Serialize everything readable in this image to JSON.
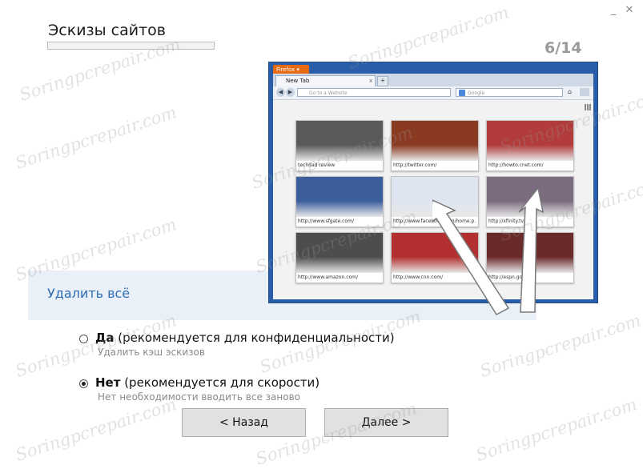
{
  "window": {
    "minimize_label": "_",
    "close_label": "✕"
  },
  "header": {
    "title": "Эскизы сайтов",
    "step": "6/14",
    "progress_fraction": 0.0
  },
  "section": {
    "label": "Удалить всё"
  },
  "browser_preview": {
    "app_button": "Firefox ▾",
    "tab_label": "New Tab",
    "tab_close": "x",
    "new_tab": "+",
    "url_placeholder": "Go to a Website",
    "search_placeholder": "Google",
    "thumbnails": [
      {
        "caption": "techdad review",
        "color": "#5a5a5a"
      },
      {
        "caption": "http://twitter.com/",
        "color": "#8b3a22"
      },
      {
        "caption": "http://howto.cnet.com/",
        "color": "#b23b3b"
      },
      {
        "caption": "http://www.sfgate.com/",
        "color": "#3b5d9c"
      },
      {
        "caption": "http://www.facebook.com/home.p...",
        "color": "#dfe5f0"
      },
      {
        "caption": "http://xfinity.tv.com/",
        "color": "#7a6b7e"
      },
      {
        "caption": "http://www.amazon.com/",
        "color": "#4d4d4d"
      },
      {
        "caption": "http://www.cnn.com/",
        "color": "#b23030"
      },
      {
        "caption": "http://espn.go.com/",
        "color": "#6a2a2a"
      }
    ]
  },
  "options": [
    {
      "title": "Да",
      "suffix": " (рекомендуется для конфиденциальности)",
      "subtitle": "Удалить кэш эскизов",
      "selected": false
    },
    {
      "title": "Нет",
      "suffix": " (рекомендуется для скорости)",
      "subtitle": "Нет необходимости вводить все заново",
      "selected": true
    }
  ],
  "buttons": {
    "back": "< Назад",
    "next": "Далее >"
  },
  "watermark": "Soringpcrepair.com"
}
